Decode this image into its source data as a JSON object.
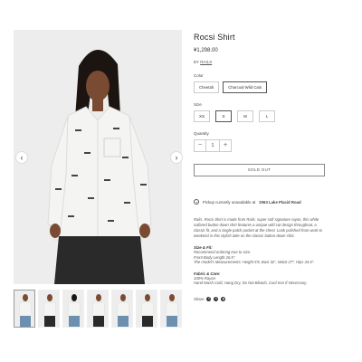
{
  "product": {
    "title": "Rocsi Shirt",
    "price": "¥1,298.00",
    "by_prefix": "BY",
    "brand": "RAILS"
  },
  "options": {
    "color_label": "Color",
    "colors": [
      {
        "label": "Cheetah",
        "selected": false
      },
      {
        "label": "Charcoal Wild Cats",
        "selected": true
      }
    ],
    "size_label": "Size",
    "sizes": [
      {
        "label": "XS",
        "selected": false
      },
      {
        "label": "S",
        "selected": true
      },
      {
        "label": "M",
        "selected": false
      },
      {
        "label": "L",
        "selected": false
      }
    ],
    "quantity_label": "Quantity",
    "quantity_value": "1",
    "decrement": "−",
    "increment": "+"
  },
  "cta": {
    "label": "SOLD OUT"
  },
  "pickup": {
    "text_prefix": "Pickup currently unavailable at",
    "location": "2063 Lake Placid Road"
  },
  "description": {
    "body": "Rails. Rocsi Shirt is made from Rails. super soft signature rayon, this white collared button down shirt features a unique wild cat design throughout, a classic fit, and a single patch pocket at the chest. Look polished from work to weekend in this stylish take on the classic button-down shirt.",
    "size_fit_title": "Size & Fit:",
    "size_fit_lines": [
      "Recommend ordering true to size.",
      "Front Body Length 26.5\".",
      "The model's Measurements: Height 5'9, Bust 32\", Waist 27\", Hips 34.5\"."
    ],
    "fabric_title": "Fabric & Care:",
    "fabric_lines": [
      "100% Rayon",
      "Hand Wash Cold, Hang Dry, Do Not Bleach, Cool Iron If Necessary."
    ]
  },
  "share": {
    "label": "Share",
    "icons": [
      "facebook-icon",
      "twitter-icon",
      "pinterest-icon"
    ]
  },
  "gallery": {
    "prev": "‹",
    "next": "›",
    "thumbnail_count": 7,
    "active_index": 0
  },
  "colors": {
    "shirt": "#f4f4f2",
    "print": "#444444",
    "skin": "#7a4b33",
    "hair": "#1c1410",
    "pants": "#2a2a2a",
    "background": "#ededed"
  }
}
